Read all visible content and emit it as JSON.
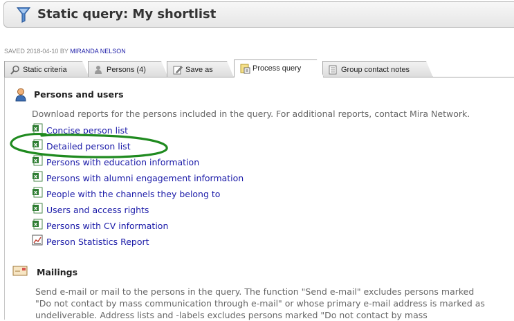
{
  "header": {
    "title": "Static query: My shortlist",
    "saved_prefix": "SAVED 2018-04-10 BY ",
    "saved_by": "MIRANDA NELSON"
  },
  "tabs": [
    {
      "label": "Static criteria",
      "icon": "magnifier-icon"
    },
    {
      "label": "Persons (4)",
      "icon": "person-icon"
    },
    {
      "label": "Save as",
      "icon": "pencil-icon"
    },
    {
      "label": "Process query",
      "icon": "process-icon",
      "active": true
    },
    {
      "label": "Group contact notes",
      "icon": "notes-icon"
    }
  ],
  "persons_section": {
    "title": "Persons and users",
    "description": "Download reports for the persons included in the query. For additional reports, contact Mira Network.",
    "reports": [
      {
        "label": "Concise person list",
        "icon": "excel-icon"
      },
      {
        "label": "Detailed person list",
        "icon": "excel-icon"
      },
      {
        "label": "Persons with education information",
        "icon": "excel-icon"
      },
      {
        "label": "Persons with alumni engagement information",
        "icon": "excel-icon"
      },
      {
        "label": "People with the channels they belong to",
        "icon": "excel-icon"
      },
      {
        "label": "Users and access rights",
        "icon": "excel-icon"
      },
      {
        "label": "Persons with CV information",
        "icon": "excel-icon"
      },
      {
        "label": "Person Statistics Report",
        "icon": "chart-report-icon"
      }
    ]
  },
  "mailings_section": {
    "title": "Mailings",
    "description_lines": [
      "Send e-mail or mail to the persons in the query. The function \"Send e-mail\" excludes persons marked",
      "\"Do not contact by mass communication through e-mail\" or whose primary e-mail address is marked as",
      "undeliverable. Address lists and -labels excludes persons marked \"Do not contact by mass"
    ]
  },
  "colors": {
    "link": "#1a1aa8",
    "annotation": "#1f8a1f",
    "tab_border": "#a8a8a8"
  }
}
